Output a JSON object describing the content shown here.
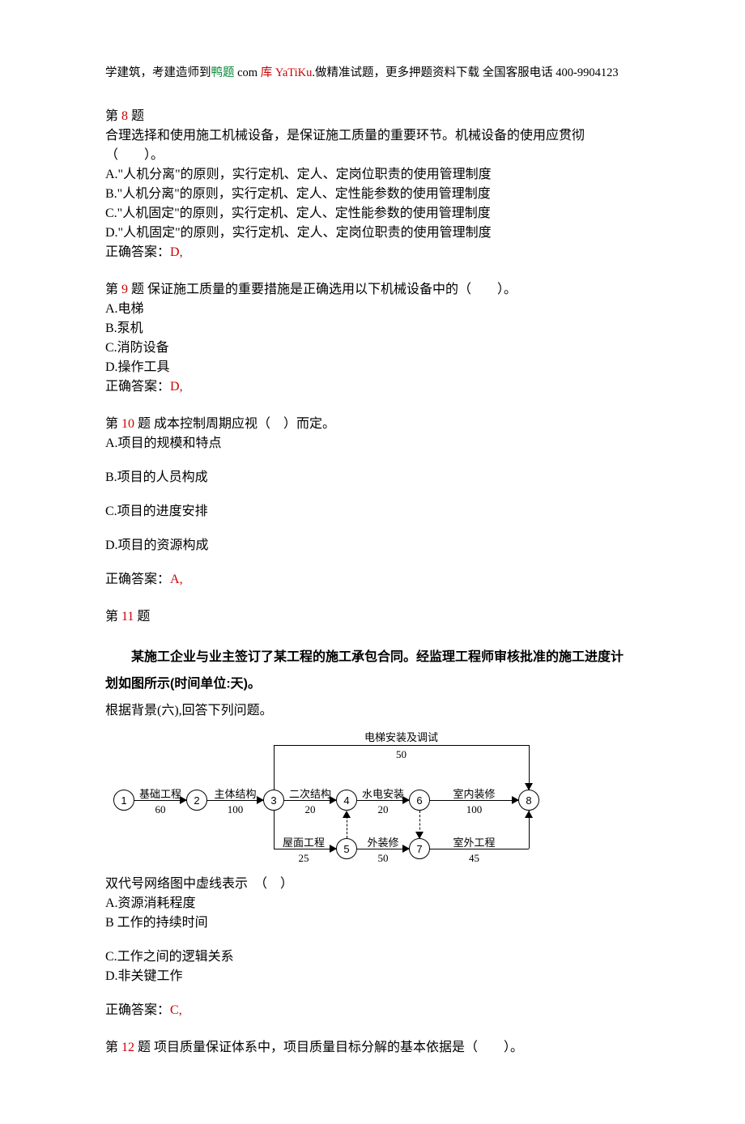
{
  "header": {
    "p1": "学建筑，考建造师到",
    "p2_green": "鸭题",
    "p3": " com ",
    "p4_red": "库 YaTiKu",
    "p5": ".做精准试题，更多押题资料下载 全国客服电话 400-9904123"
  },
  "q8": {
    "title_pre": "第 ",
    "num": "8",
    "title_post": " 题",
    "stem1": "合理选择和使用施工机械设备，是保证施工质量的重要环节。机械设备的使用应贯彻",
    "stem2": "（　　）。",
    "A": "A.\"人机分离\"的原则，实行定机、定人、定岗位职责的使用管理制度",
    "B": "B.\"人机分离\"的原则，实行定机、定人、定性能参数的使用管理制度",
    "C": "C.\"人机固定\"的原则，实行定机、定人、定性能参数的使用管理制度",
    "D": "D.\"人机固定\"的原则，实行定机、定人、定岗位职责的使用管理制度",
    "ans_label": "正确答案：",
    "ans": "D,"
  },
  "q9": {
    "title_pre": "第 ",
    "num": "9",
    "title_post": " 题 保证施工质量的重要措施是正确选用以下机械设备中的（　　）。",
    "A": "A.电梯",
    "B": "B.泵机",
    "C": "C.消防设备",
    "D": "D.操作工具",
    "ans_label": "正确答案：",
    "ans": "D,"
  },
  "q10": {
    "title_pre": "第 ",
    "num": "10",
    "title_post": " 题 成本控制周期应视（　）而定。",
    "A": "A.项目的规模和特点",
    "B": "B.项目的人员构成",
    "C": "C.项目的进度安排",
    "D": "D.项目的资源构成",
    "ans_label": "正确答案：",
    "ans": "A,"
  },
  "q11": {
    "title_pre": "第 ",
    "num": "11",
    "title_post": " 题",
    "intro1": "　　某施工企业与业主签订了某工程的施工承包合同。经监理工程师审核批准的施工进度计",
    "intro2": "划如图所示(时间单位:天)。",
    "intro3": "根据背景(六),回答下列问题。",
    "stem": "双代号网络图中虚线表示　（　）",
    "A": "A.资源消耗程度",
    "B": "B 工作的持续时间",
    "C": "C.工作之间的逻辑关系",
    "D": "D.非关键工作",
    "ans_label": "正确答案：",
    "ans": "C,"
  },
  "q12": {
    "title_pre": "第 ",
    "num": "12",
    "title_post": " 题 项目质量保证体系中，项目质量目标分解的基本依据是（　　）。"
  },
  "diagram": {
    "nodes": [
      "1",
      "2",
      "3",
      "4",
      "5",
      "6",
      "7",
      "8"
    ],
    "edges": {
      "e12": {
        "label": "基础工程",
        "dur": "60"
      },
      "e23": {
        "label": "主体结构",
        "dur": "100"
      },
      "e34": {
        "label": "二次结构",
        "dur": "20"
      },
      "e46": {
        "label": "水电安装",
        "dur": "20"
      },
      "e68": {
        "label": "室内装修",
        "dur": "100"
      },
      "e38": {
        "label": "电梯安装及调试",
        "dur": "50"
      },
      "e35": {
        "label": "屋面工程",
        "dur": "25"
      },
      "e57": {
        "label": "外装修",
        "dur": "50"
      },
      "e78": {
        "label": "室外工程",
        "dur": "45"
      }
    }
  }
}
